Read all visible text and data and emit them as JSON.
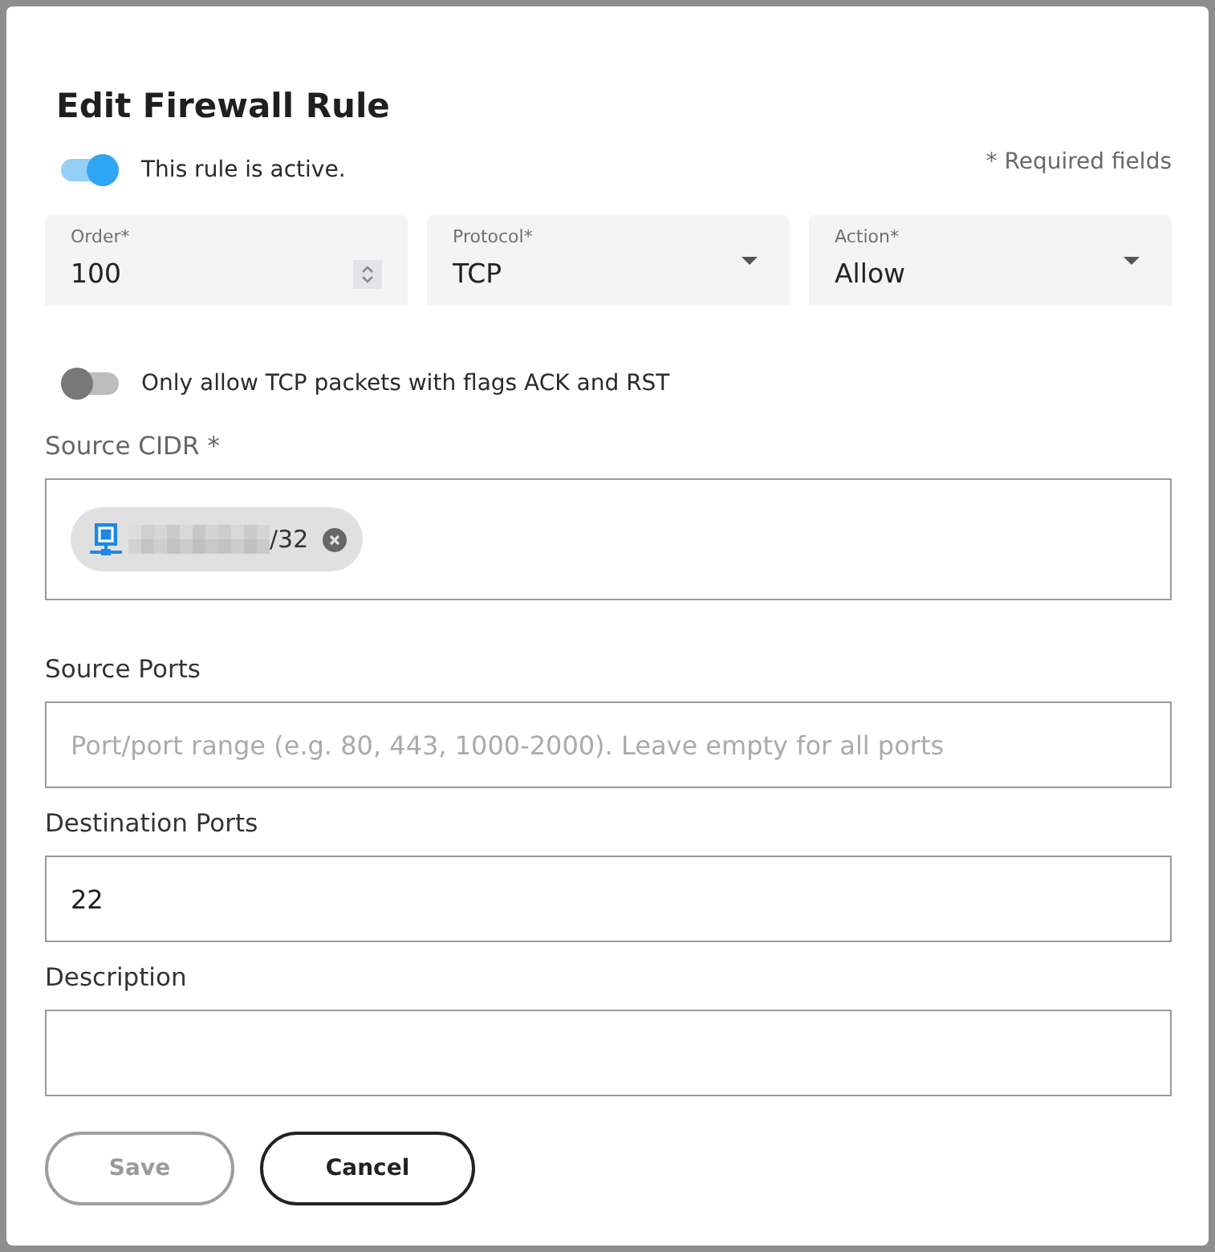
{
  "dialog": {
    "title": "Edit Firewall Rule"
  },
  "active_toggle": {
    "label": "This rule is active.",
    "on": true
  },
  "required_note": "* Required fields",
  "fields": [
    {
      "kind": "number",
      "label": "Order*",
      "value": "100"
    },
    {
      "kind": "select",
      "label": "Protocol*",
      "value": "TCP"
    },
    {
      "kind": "select",
      "label": "Action*",
      "value": "Allow"
    }
  ],
  "tcp_flags_toggle": {
    "label": "Only allow TCP packets with flags ACK and RST",
    "on": false
  },
  "source_cidr": {
    "label": "Source CIDR *",
    "chips": [
      {
        "redacted": true,
        "text": "/32"
      }
    ]
  },
  "text_inputs": [
    {
      "label": "Source Ports",
      "placeholder": "Port/port range (e.g. 80, 443, 1000-2000). Leave empty for all ports"
    },
    {
      "label": "Destination Ports",
      "value": "22"
    },
    {
      "label": "Description"
    }
  ],
  "buttons": [
    {
      "label": "Save",
      "disabled": true
    },
    {
      "label": "Cancel",
      "disabled": false
    }
  ]
}
